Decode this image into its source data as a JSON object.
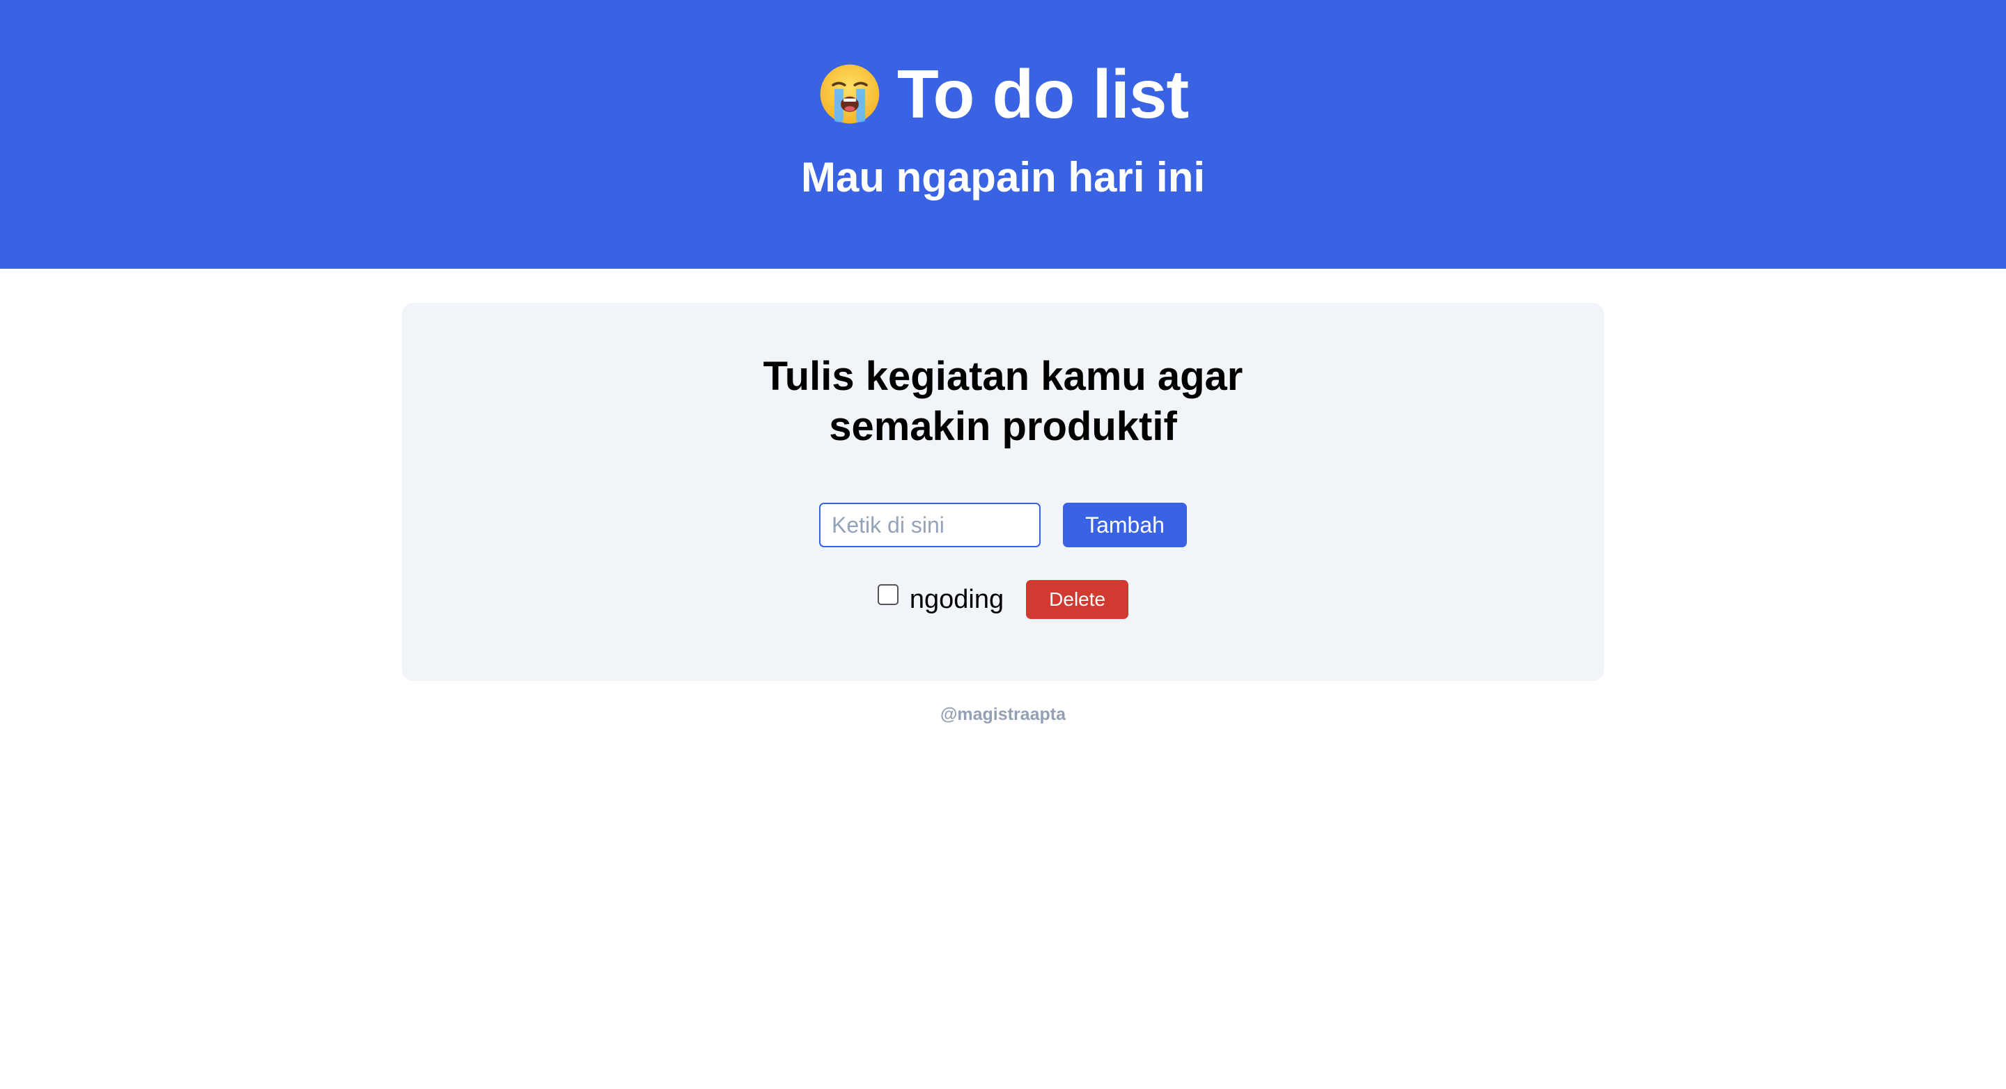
{
  "header": {
    "emoji_icon": "loudly-crying-face-icon",
    "title": "To do list",
    "subtitle": "Mau ngapain hari ini",
    "background_color": "#3a63e4"
  },
  "card": {
    "heading_line1": "Tulis kegiatan kamu agar",
    "heading_line2": "semakin produktif",
    "input": {
      "placeholder": "Ketik di sini",
      "value": ""
    },
    "add_button_label": "Tambah",
    "todos": [
      {
        "text": "ngoding",
        "checked": false,
        "delete_label": "Delete"
      }
    ]
  },
  "footer": {
    "credit": "@magistraapta"
  },
  "colors": {
    "primary": "#3a63e4",
    "danger": "#d13a31",
    "card_bg": "#f1f4f9",
    "muted_text": "#94a0b4"
  }
}
